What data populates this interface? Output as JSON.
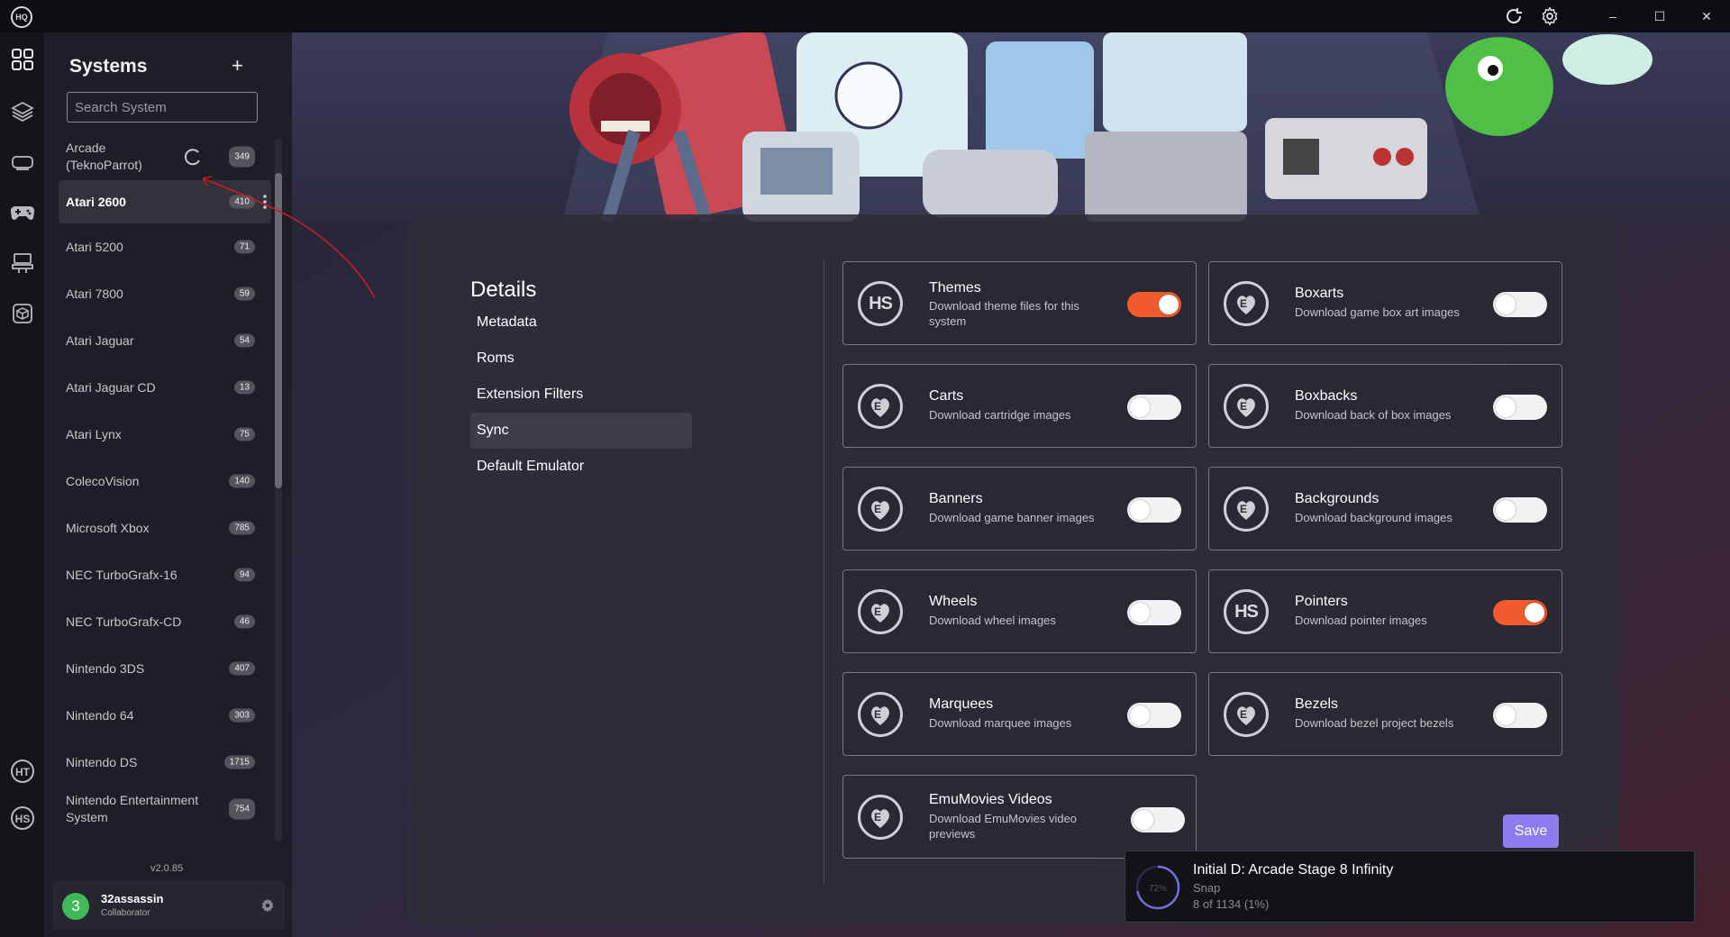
{
  "titlebar": {
    "logo_text": "HQ",
    "minimize": "–",
    "maximize": "☐",
    "close": "✕"
  },
  "sidebar": {
    "title": "Systems",
    "add_label": "+",
    "search_placeholder": "Search System",
    "items": [
      {
        "name": "Arcade (TeknoParrot)",
        "count": "349"
      },
      {
        "name": "Atari 2600",
        "count": "410"
      },
      {
        "name": "Atari 5200",
        "count": "71"
      },
      {
        "name": "Atari 7800",
        "count": "59"
      },
      {
        "name": "Atari Jaguar",
        "count": "54"
      },
      {
        "name": "Atari Jaguar CD",
        "count": "13"
      },
      {
        "name": "Atari Lynx",
        "count": "75"
      },
      {
        "name": "ColecoVision",
        "count": "140"
      },
      {
        "name": "Microsoft Xbox",
        "count": "785"
      },
      {
        "name": "NEC TurboGrafx-16",
        "count": "94"
      },
      {
        "name": "NEC TurboGrafx-CD",
        "count": "46"
      },
      {
        "name": "Nintendo 3DS",
        "count": "407"
      },
      {
        "name": "Nintendo 64",
        "count": "303"
      },
      {
        "name": "Nintendo DS",
        "count": "1715"
      },
      {
        "name": "Nintendo Entertainment System",
        "count": "754"
      }
    ],
    "selected_index": 1,
    "version": "v2.0.85",
    "user": {
      "avatar": "3",
      "name": "32assassin",
      "role": "Collaborator"
    }
  },
  "details": {
    "title": "Details",
    "nav": [
      "Metadata",
      "Roms",
      "Extension Filters",
      "Sync",
      "Default Emulator"
    ],
    "selected_nav": "Sync"
  },
  "sync": {
    "cards": [
      {
        "title": "Themes",
        "desc": "Download theme files for this system",
        "icon": "hs-logo-icon",
        "enabled": true
      },
      {
        "title": "Boxarts",
        "desc": "Download game box art images",
        "icon": "emumovies-icon",
        "enabled": false
      },
      {
        "title": "Carts",
        "desc": "Download cartridge images",
        "icon": "emumovies-icon",
        "enabled": false
      },
      {
        "title": "Boxbacks",
        "desc": "Download back of box images",
        "icon": "emumovies-icon",
        "enabled": false
      },
      {
        "title": "Banners",
        "desc": "Download game banner images",
        "icon": "emumovies-icon",
        "enabled": false
      },
      {
        "title": "Backgrounds",
        "desc": "Download background images",
        "icon": "emumovies-icon",
        "enabled": false
      },
      {
        "title": "Wheels",
        "desc": "Download wheel images",
        "icon": "emumovies-icon",
        "enabled": false
      },
      {
        "title": "Pointers",
        "desc": "Download pointer images",
        "icon": "hs-logo-icon",
        "enabled": true
      },
      {
        "title": "Marquees",
        "desc": "Download marquee images",
        "icon": "emumovies-icon",
        "enabled": false
      },
      {
        "title": "Bezels",
        "desc": "Download bezel project bezels",
        "icon": "emumovies-icon",
        "enabled": false
      },
      {
        "title": "EmuMovies Videos",
        "desc": "Download EmuMovies video previews",
        "icon": "emumovies-icon",
        "enabled": false
      }
    ],
    "save_label": "Save"
  },
  "toast": {
    "percent_label": "72%",
    "progress": 0.72,
    "title": "Initial D: Arcade Stage 8 Infinity",
    "subtitle": "Snap",
    "progress_text": "8 of 1134 (1%)"
  },
  "colors": {
    "toggle_on": "#f05a2c",
    "save_button": "#8f7cf0",
    "avatar": "#3eb85a"
  }
}
